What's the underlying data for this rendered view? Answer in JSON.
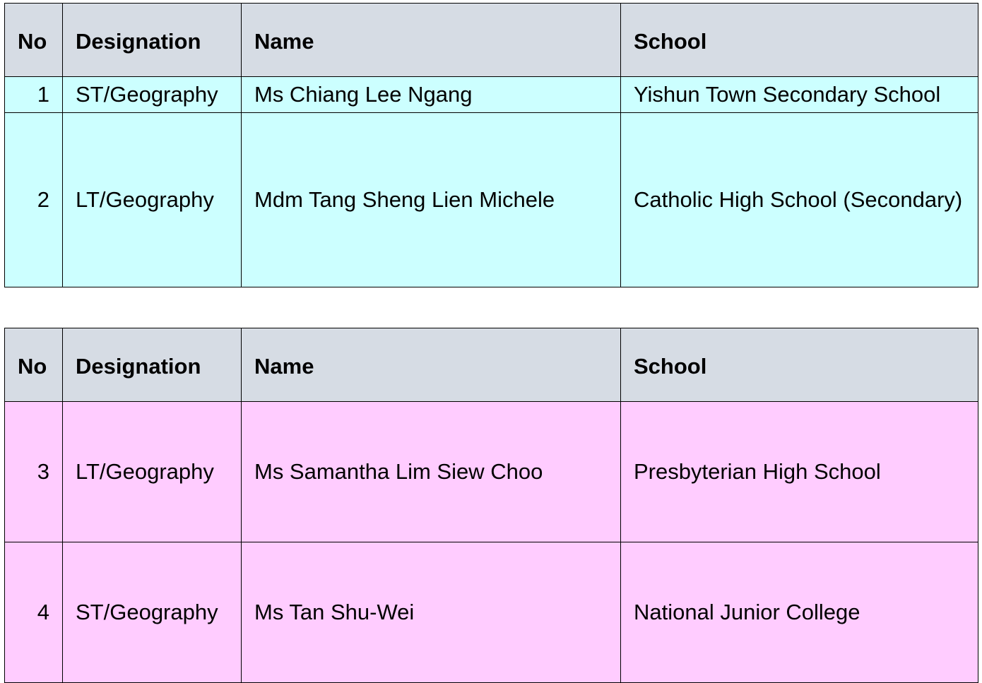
{
  "headers": {
    "no": "No",
    "designation": "Designation",
    "name": "Name",
    "school": "School"
  },
  "table1": {
    "rows": [
      {
        "no": "1",
        "designation": "ST/Geography",
        "name": "Ms Chiang Lee Ngang",
        "school": "Yishun Town Secondary School"
      },
      {
        "no": "2",
        "designation": "LT/Geography",
        "name": "Mdm Tang Sheng Lien Michele",
        "school": "Catholic High School (Secondary)"
      }
    ]
  },
  "table2": {
    "rows": [
      {
        "no": "3",
        "designation": "LT/Geography",
        "name": "Ms Samantha Lim Siew Choo",
        "school": "Presbyterian High School"
      },
      {
        "no": "4",
        "designation": "ST/Geography",
        "name": "Ms Tan Shu-Wei",
        "school": "National Junior College"
      }
    ]
  },
  "colors": {
    "header_bg": "#d6dce4",
    "table1_row_bg": "#ccffff",
    "table2_row_bg": "#ffccff",
    "border": "#000000"
  }
}
